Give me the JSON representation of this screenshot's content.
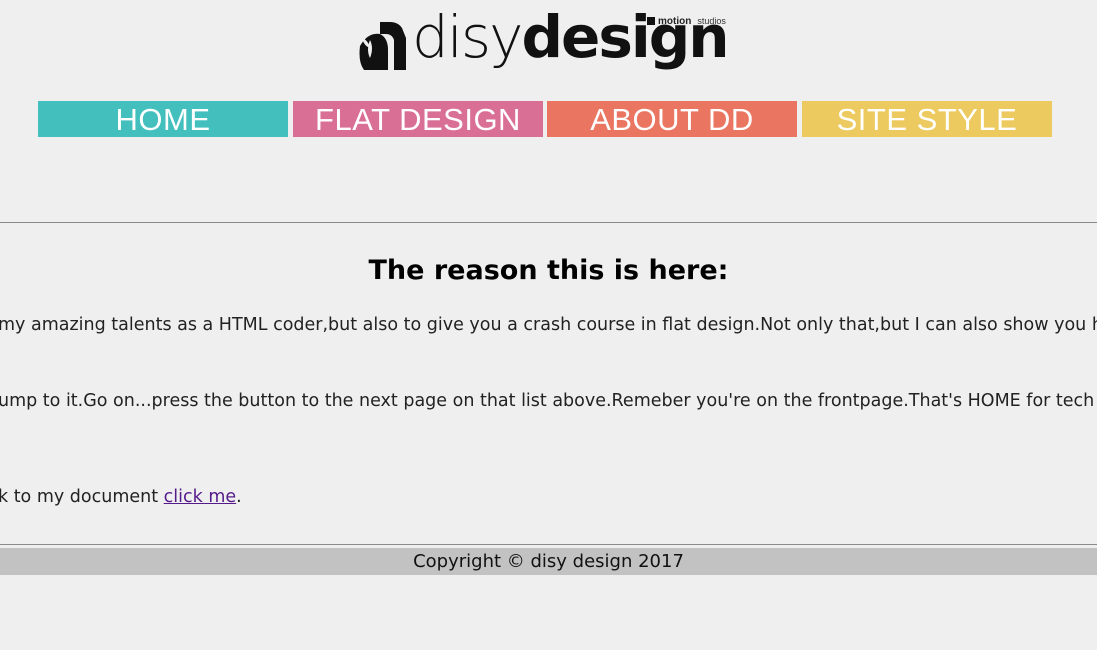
{
  "logo": {
    "word_light": "disy",
    "word_bold": "design",
    "sub_motion": "motion",
    "sub_studios": "studios"
  },
  "nav": {
    "items": [
      {
        "label": "HOME",
        "color": "#43bfbd"
      },
      {
        "label": "FLAT DESIGN",
        "color": "#da6f96"
      },
      {
        "label": "ABOUT DD",
        "color": "#ea7662"
      },
      {
        "label": "SITE STYLE",
        "color": "#ecca5f"
      }
    ]
  },
  "main": {
    "heading": "The reason this is here:",
    "paragraph_1": "my amazing talents as a HTML coder,but also to give you a crash course in flat design.Not only that,but I can also show you h",
    "paragraph_2": "ump to it.Go on...press the button to the next page on that list above.Remeber you're on the frontpage.That's HOME for tech",
    "paragraph_3_prefix": "k to my document ",
    "paragraph_3_link": "click me",
    "paragraph_3_suffix": "."
  },
  "footer": {
    "copyright": "Copyright © disy design 2017"
  }
}
